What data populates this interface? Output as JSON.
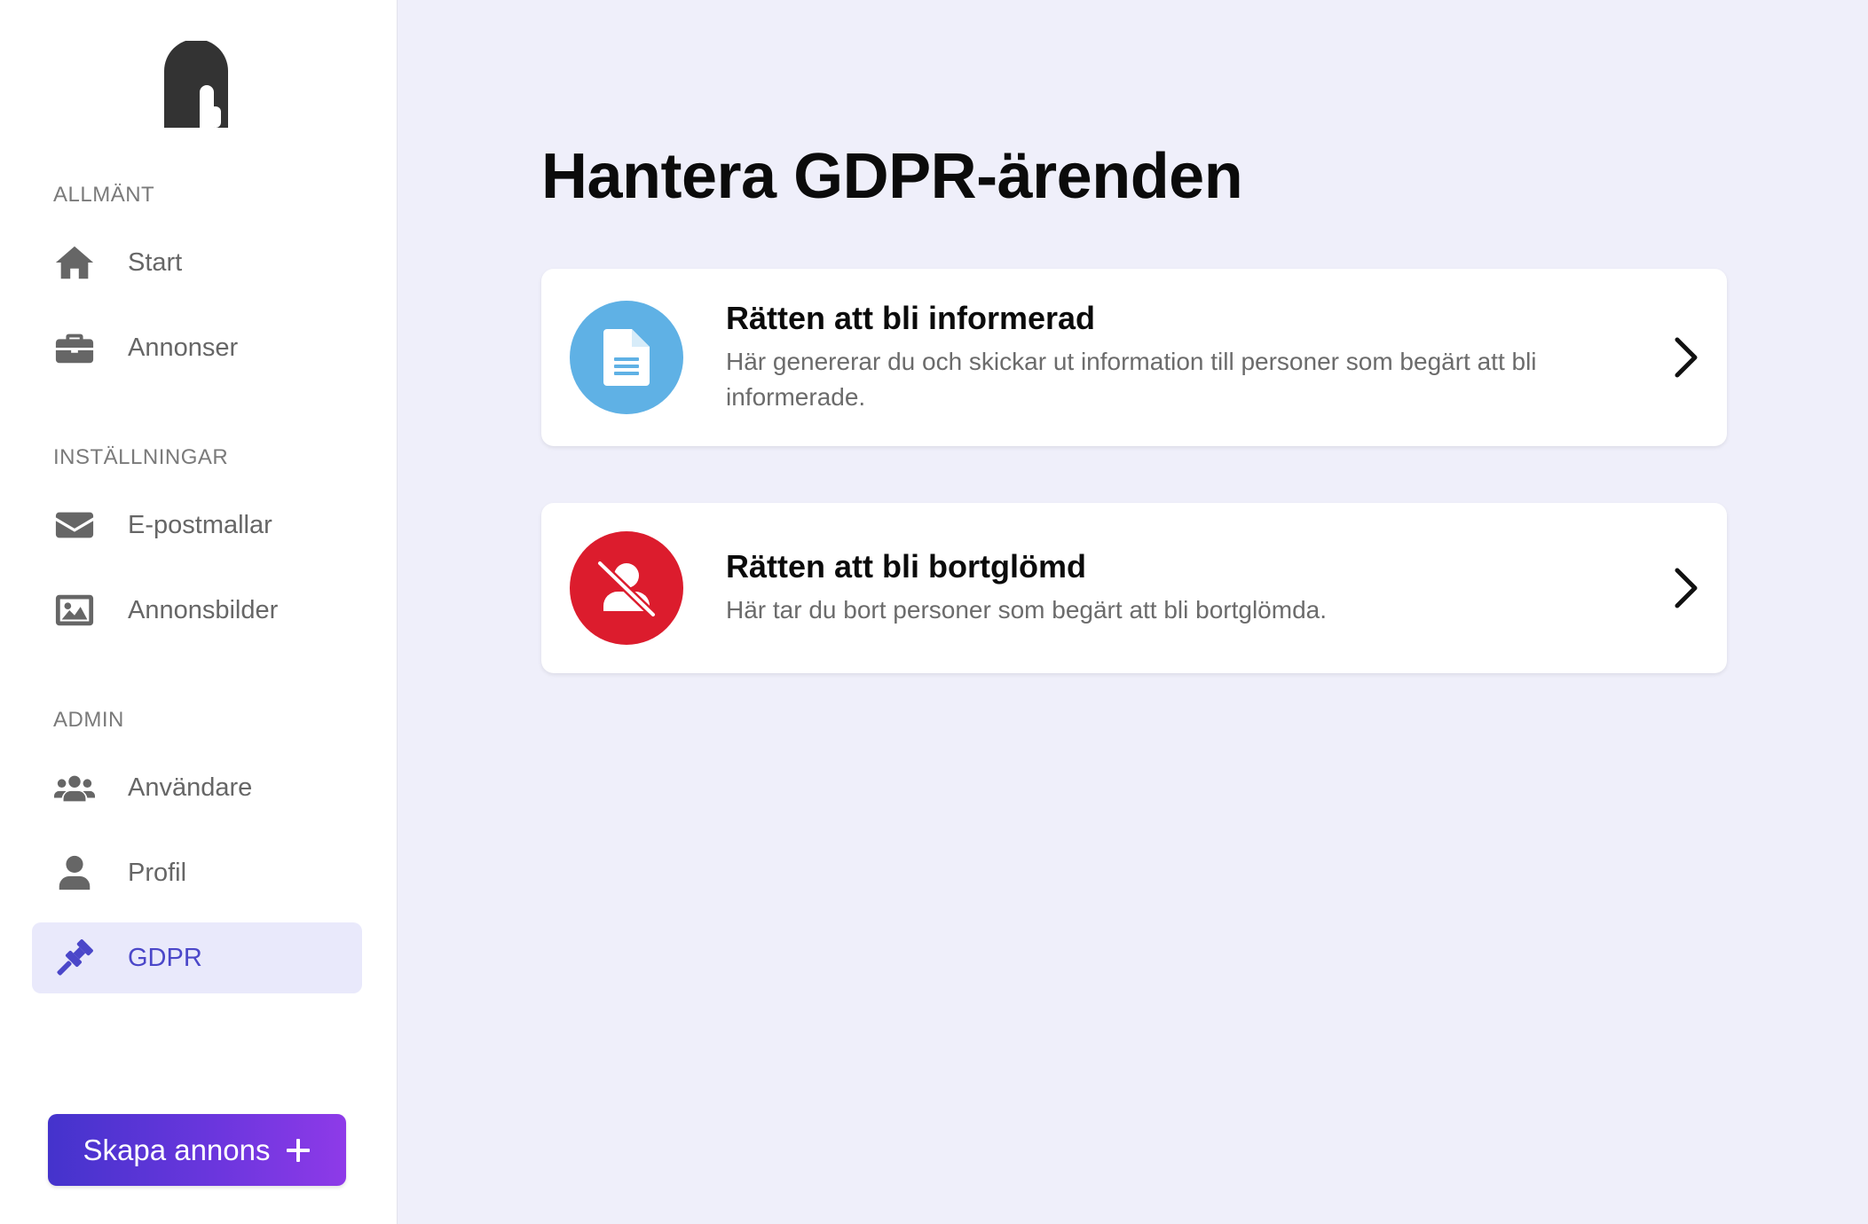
{
  "sidebar": {
    "sections": {
      "general": "ALLMÄNT",
      "settings": "INSTÄLLNINGAR",
      "admin": "ADMIN"
    },
    "items": [
      {
        "label": "Start",
        "icon": "home-icon"
      },
      {
        "label": "Annonser",
        "icon": "briefcase-icon"
      },
      {
        "label": "E-postmallar",
        "icon": "envelope-icon"
      },
      {
        "label": "Annonsbilder",
        "icon": "image-icon"
      },
      {
        "label": "Användare",
        "icon": "users-icon"
      },
      {
        "label": "Profil",
        "icon": "user-icon"
      },
      {
        "label": "GDPR",
        "icon": "gavel-icon",
        "active": true
      }
    ],
    "create_button": "Skapa annons"
  },
  "main": {
    "title": "Hantera GDPR-ärenden",
    "cards": [
      {
        "title": "Rätten att bli informerad",
        "description": "Här genererar du och skickar ut information till personer som begärt att bli informerade.",
        "icon": "document-icon",
        "color": "#5fb1e5"
      },
      {
        "title": "Rätten att bli bortglömd",
        "description": "Här tar du bort personer som begärt att bli bortglömda.",
        "icon": "user-slash-icon",
        "color": "#dc1c2d"
      }
    ]
  },
  "colors": {
    "accent": "#4b47c9",
    "background": "#efeffa",
    "active_bg": "#e9e9fb"
  }
}
